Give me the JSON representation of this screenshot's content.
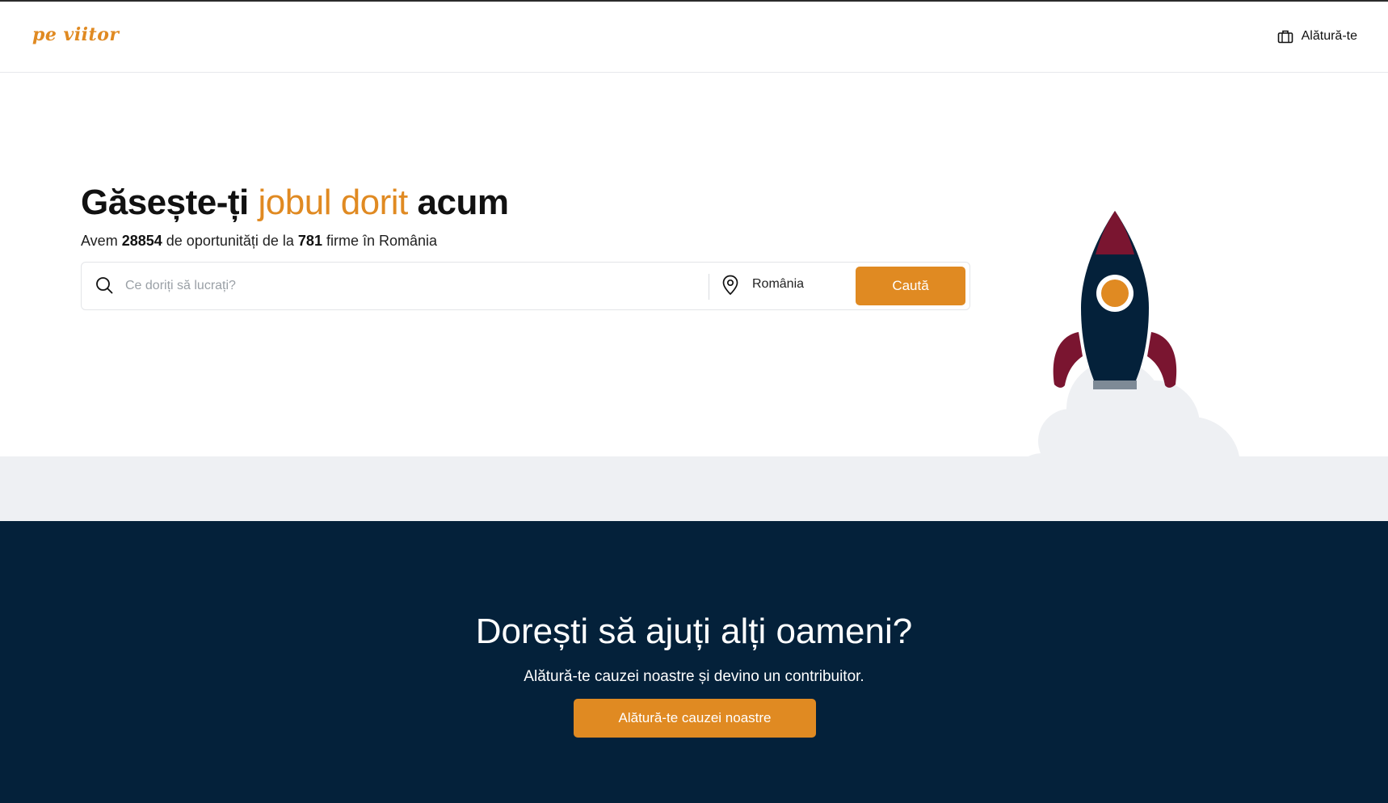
{
  "header": {
    "logo_text": "pe viitor",
    "join_label": "Alătură-te",
    "join_icon": "briefcase-icon"
  },
  "hero": {
    "headline_start": "Găsește-ți",
    "headline_accent": "jobul dorit",
    "headline_end": "acum",
    "sub_prefix": "Avem",
    "jobs_count": "28854",
    "sub_middle": "de oportunități de la",
    "companies_count": "781",
    "sub_suffix": "firme în România"
  },
  "search": {
    "placeholder": "Ce doriți să lucrați?",
    "location": "România",
    "button_label": "Caută",
    "search_icon": "search-icon",
    "location_icon": "map-pin-icon"
  },
  "cta": {
    "title": "Dorești să ajuți alți oameni?",
    "subtitle": "Alătură-te cauzei noastre și devino un contribuitor.",
    "button_label": "Alătură-te cauzei noastre"
  },
  "colors": {
    "accent": "#e08a22",
    "navy": "#04213a",
    "rocket_red": "#7a1530",
    "cloud": "#eef0f3"
  }
}
